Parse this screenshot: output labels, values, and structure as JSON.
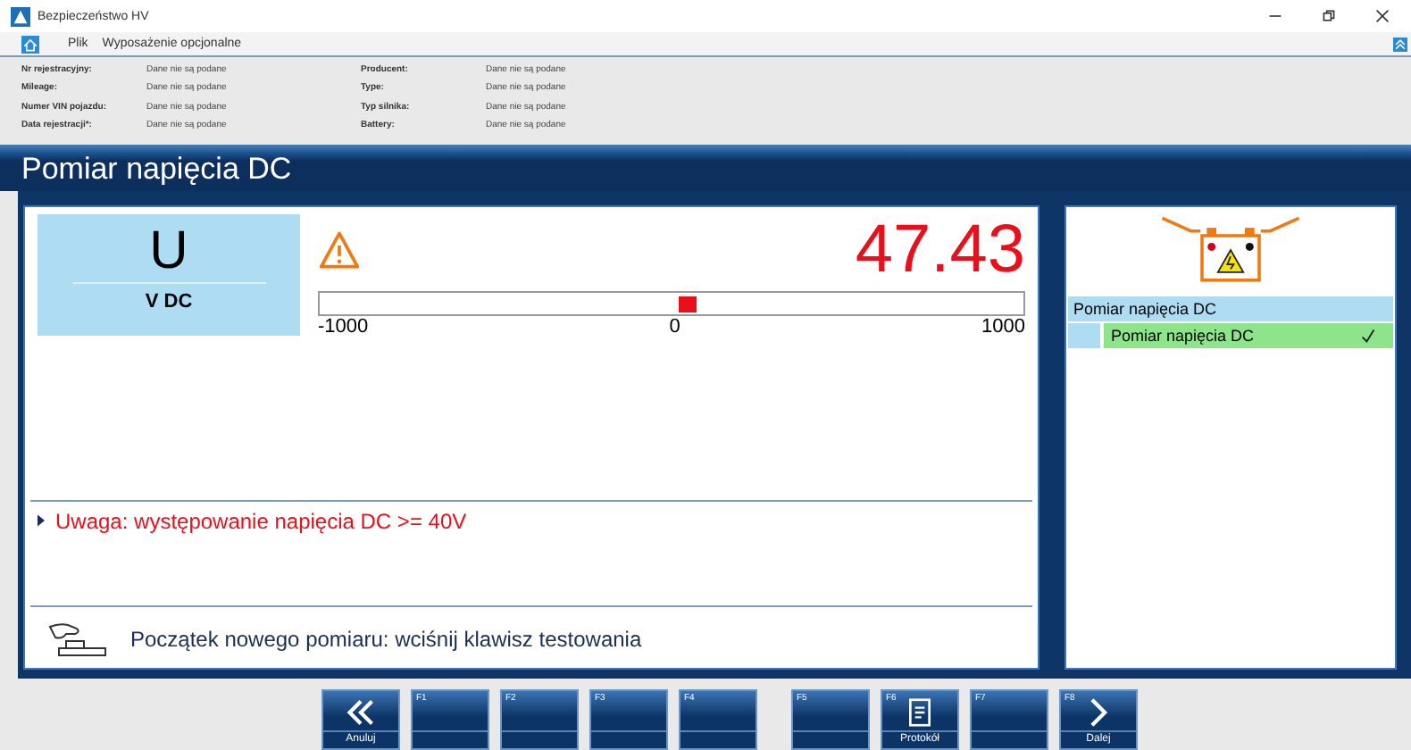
{
  "window": {
    "title": "Bezpieczeństwo HV"
  },
  "menu": [
    "Plik",
    "Wyposażenie opcjonalne"
  ],
  "vehicle_info": [
    [
      {
        "label": "Nr rejestracyjny:",
        "value": "Dane nie są podane"
      },
      {
        "label": "Mileage:",
        "value": "Dane nie są podane"
      },
      {
        "label": "Numer VIN pojazdu:",
        "value": "Dane nie są podane"
      },
      {
        "label": "Data rejestracji*:",
        "value": "Dane nie są podane"
      }
    ],
    [
      {
        "label": "Producent:",
        "value": "Dane nie są podane"
      },
      {
        "label": "Type:",
        "value": "Dane nie są podane"
      },
      {
        "label": "Typ silnika:",
        "value": "Dane nie są podane"
      },
      {
        "label": "Battery:",
        "value": "Dane nie są podane"
      }
    ]
  ],
  "page_title": "Pomiar napięcia DC",
  "measurement": {
    "symbol": "U",
    "unit": "V DC",
    "reading": "47.43",
    "warning": true,
    "level": 0.524,
    "scale": [
      "-1000",
      "0",
      "1000"
    ]
  },
  "notice": "Uwaga: występowanie napięcia DC >= 40V",
  "instruction": "Początek nowego pomiaru: wciśnij klawisz testowania",
  "steps": [
    {
      "label": "Pomiar napięcia DC",
      "children": [
        {
          "label": "Pomiar napięcia DC",
          "done": true
        }
      ]
    }
  ],
  "function_key_groups": [
    [
      {
        "label": "Anuluj",
        "kind": "back"
      },
      {
        "key": "F1",
        "kind": "empty"
      },
      {
        "key": "F2",
        "kind": "empty"
      },
      {
        "key": "F3",
        "kind": "empty"
      },
      {
        "key": "F4",
        "kind": "empty"
      }
    ],
    [
      {
        "key": "F5",
        "kind": "empty"
      },
      {
        "key": "F6",
        "label": "Protokół",
        "kind": "document"
      },
      {
        "key": "F7",
        "kind": "empty"
      },
      {
        "key": "F8",
        "label": "Dalej",
        "kind": "next"
      }
    ]
  ]
}
